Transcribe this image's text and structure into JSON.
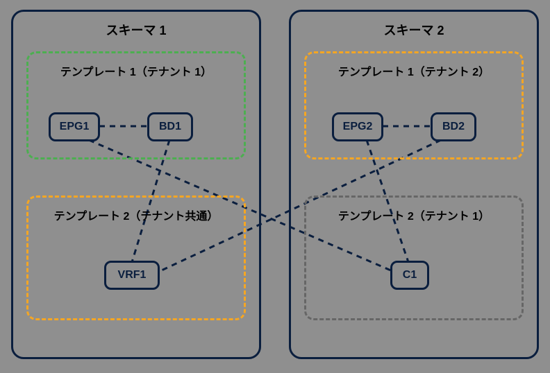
{
  "schema1": {
    "title": "スキーマ 1",
    "template1": {
      "title": "テンプレート 1（テナント 1）",
      "nodes": {
        "epg1": "EPG1",
        "bd1": "BD1"
      },
      "border_color": "#4caf50"
    },
    "template2": {
      "title": "テンプレート 2（テナント共通）",
      "nodes": {
        "vrf1": "VRF1"
      },
      "border_color": "#f5a623"
    }
  },
  "schema2": {
    "title": "スキーマ 2",
    "template1": {
      "title": "テンプレート 1（テナント 2）",
      "nodes": {
        "epg2": "EPG2",
        "bd2": "BD2"
      },
      "border_color": "#f5a623"
    },
    "template2": {
      "title": "テンプレート 2（テナント 1）",
      "nodes": {
        "c1": "C1"
      },
      "border_color": "#666666"
    }
  },
  "colors": {
    "outline": "#0a1e3e",
    "dash": "#0a1e3e"
  },
  "edges": [
    {
      "from": "epg1",
      "to": "bd1"
    },
    {
      "from": "epg2",
      "to": "bd2"
    },
    {
      "from": "bd1",
      "to": "vrf1"
    },
    {
      "from": "bd2",
      "to": "vrf1"
    },
    {
      "from": "epg1",
      "to": "c1"
    },
    {
      "from": "epg2",
      "to": "c1"
    }
  ]
}
